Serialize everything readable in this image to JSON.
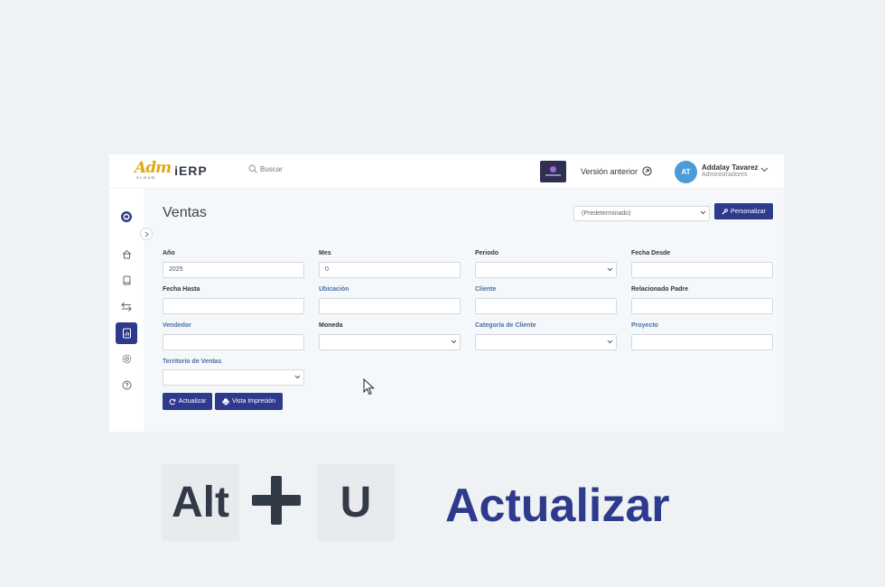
{
  "app": {
    "logo_text": "Adm",
    "logo_sub": "CLOUD",
    "logo_suffix": "iERP"
  },
  "header": {
    "search_placeholder": "Buscar",
    "previous_version": "Versión anterior",
    "user": {
      "initials": "AT",
      "name": "Addalay Tavarez",
      "role": "Administradores"
    }
  },
  "sidebar": {
    "items": [
      "company-icon",
      "home-icon",
      "book-icon",
      "transfer-icon",
      "report-icon",
      "settings-icon",
      "help-icon"
    ],
    "active": "report-icon"
  },
  "page": {
    "title": "Ventas",
    "layout_select": "(Predeterminado)",
    "customize_button": "Personalizar",
    "fields": {
      "anio": {
        "label": "Año",
        "value": "2025"
      },
      "mes": {
        "label": "Mes",
        "value": "0"
      },
      "periodo": {
        "label": "Periodo",
        "value": ""
      },
      "fecha_desde": {
        "label": "Fecha Desde",
        "value": ""
      },
      "fecha_hasta": {
        "label": "Fecha Hasta",
        "value": ""
      },
      "ubicacion": {
        "label": "Ubicación",
        "value": ""
      },
      "cliente": {
        "label": "Cliente",
        "value": ""
      },
      "relacionado_padre": {
        "label": "Relacionado Padre",
        "value": ""
      },
      "vendedor": {
        "label": "Vendedor",
        "value": ""
      },
      "moneda": {
        "label": "Moneda",
        "value": ""
      },
      "categoria_cliente": {
        "label": "Categoría de Cliente",
        "value": ""
      },
      "proyecto": {
        "label": "Proyecto",
        "value": ""
      },
      "territorio_ventas": {
        "label": "Territorio de Ventas",
        "value": ""
      }
    },
    "refresh_button": "Actualizar",
    "print_button": "Vista Impresión"
  },
  "shortcut": {
    "key1": "Alt",
    "plus": "+",
    "key2": "U",
    "action": "Actualizar"
  },
  "colors": {
    "primary": "#2e3a8c",
    "background": "#eef2f4",
    "avatar": "#4a9bd6",
    "link_label": "#4b6ea8"
  }
}
